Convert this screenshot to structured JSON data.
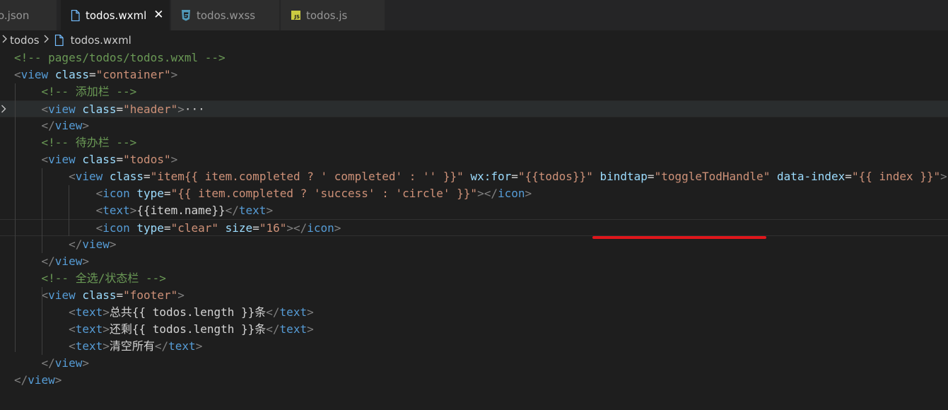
{
  "tabs": [
    {
      "label": "o.json",
      "icon": "json-file-icon",
      "active": false
    },
    {
      "label": "todos.wxml",
      "icon": "file-icon",
      "active": true
    },
    {
      "label": "todos.wxss",
      "icon": "css-file-icon",
      "active": false
    },
    {
      "label": "todos.js",
      "icon": "js-file-icon",
      "active": false
    }
  ],
  "tab_close_glyph": "✕",
  "js_badge_text": "JS",
  "breadcrumb": {
    "folder": "todos",
    "file": "todos.wxml"
  },
  "colors": {
    "tag": "#569cd6",
    "attribute": "#9cdcfe",
    "string": "#ce9178",
    "comment": "#6a9955",
    "bracket": "#808080",
    "annotation_underline": "#e0161b"
  },
  "code_lines": [
    [
      [
        "com",
        "<!-- pages/todos/todos.wxml -->"
      ]
    ],
    [
      [
        "b",
        "<"
      ],
      [
        "tag",
        "view"
      ],
      [
        "txt",
        " "
      ],
      [
        "attr",
        "class"
      ],
      [
        "txt",
        "="
      ],
      [
        "str",
        "\"container\""
      ],
      [
        "b",
        ">"
      ]
    ],
    [
      [
        "txt",
        "    "
      ],
      [
        "com",
        "<!-- 添加栏 -->"
      ]
    ],
    [
      [
        "txt",
        "    "
      ],
      [
        "b",
        "<"
      ],
      [
        "tag",
        "view"
      ],
      [
        "txt",
        " "
      ],
      [
        "attr",
        "class"
      ],
      [
        "txt",
        "="
      ],
      [
        "str",
        "\"header\""
      ],
      [
        "b",
        ">"
      ],
      [
        "ell",
        "···"
      ]
    ],
    [
      [
        "txt",
        "    "
      ],
      [
        "b",
        "</"
      ],
      [
        "tag",
        "view"
      ],
      [
        "b",
        ">"
      ]
    ],
    [
      [
        "txt",
        "    "
      ],
      [
        "com",
        "<!-- 待办栏 -->"
      ]
    ],
    [
      [
        "txt",
        "    "
      ],
      [
        "b",
        "<"
      ],
      [
        "tag",
        "view"
      ],
      [
        "txt",
        " "
      ],
      [
        "attr",
        "class"
      ],
      [
        "txt",
        "="
      ],
      [
        "str",
        "\"todos\""
      ],
      [
        "b",
        ">"
      ]
    ],
    [
      [
        "txt",
        "        "
      ],
      [
        "b",
        "<"
      ],
      [
        "tag",
        "view"
      ],
      [
        "txt",
        " "
      ],
      [
        "attr",
        "class"
      ],
      [
        "txt",
        "="
      ],
      [
        "str",
        "\"item{{ item.completed ? ' completed' : '' }}\""
      ],
      [
        "txt",
        " "
      ],
      [
        "attr",
        "wx:for"
      ],
      [
        "txt",
        "="
      ],
      [
        "str",
        "\"{{todos}}\""
      ],
      [
        "txt",
        " "
      ],
      [
        "attr",
        "bindtap"
      ],
      [
        "txt",
        "="
      ],
      [
        "str",
        "\"toggleTodHandle\""
      ],
      [
        "txt",
        " "
      ],
      [
        "attr",
        "data-index"
      ],
      [
        "txt",
        "="
      ],
      [
        "str",
        "\"{{ index }}\""
      ],
      [
        "b",
        ">"
      ]
    ],
    [
      [
        "txt",
        "            "
      ],
      [
        "b",
        "<"
      ],
      [
        "tag",
        "icon"
      ],
      [
        "txt",
        " "
      ],
      [
        "attr",
        "type"
      ],
      [
        "txt",
        "="
      ],
      [
        "str",
        "\"{{ item.completed ? 'success' : 'circle' }}\""
      ],
      [
        "b",
        "></"
      ],
      [
        "tag",
        "icon"
      ],
      [
        "b",
        ">"
      ]
    ],
    [
      [
        "txt",
        "            "
      ],
      [
        "b",
        "<"
      ],
      [
        "tag",
        "text"
      ],
      [
        "b",
        ">"
      ],
      [
        "txt",
        "{{item.name}}"
      ],
      [
        "b",
        "</"
      ],
      [
        "tag",
        "text"
      ],
      [
        "b",
        ">"
      ]
    ],
    [
      [
        "txt",
        "            "
      ],
      [
        "b",
        "<"
      ],
      [
        "tag",
        "icon"
      ],
      [
        "txt",
        " "
      ],
      [
        "attr",
        "type"
      ],
      [
        "txt",
        "="
      ],
      [
        "str",
        "\"clear\""
      ],
      [
        "txt",
        " "
      ],
      [
        "attr",
        "size"
      ],
      [
        "txt",
        "="
      ],
      [
        "str",
        "\"16\""
      ],
      [
        "b",
        "></"
      ],
      [
        "tag",
        "icon"
      ],
      [
        "b",
        ">"
      ]
    ],
    [
      [
        "txt",
        "        "
      ],
      [
        "b",
        "</"
      ],
      [
        "tag",
        "view"
      ],
      [
        "b",
        ">"
      ]
    ],
    [
      [
        "txt",
        "    "
      ],
      [
        "b",
        "</"
      ],
      [
        "tag",
        "view"
      ],
      [
        "b",
        ">"
      ]
    ],
    [
      [
        "txt",
        "    "
      ],
      [
        "com",
        "<!-- 全选/状态栏 -->"
      ]
    ],
    [
      [
        "txt",
        "    "
      ],
      [
        "b",
        "<"
      ],
      [
        "tag",
        "view"
      ],
      [
        "txt",
        " "
      ],
      [
        "attr",
        "class"
      ],
      [
        "txt",
        "="
      ],
      [
        "str",
        "\"footer\""
      ],
      [
        "b",
        ">"
      ]
    ],
    [
      [
        "txt",
        "        "
      ],
      [
        "b",
        "<"
      ],
      [
        "tag",
        "text"
      ],
      [
        "b",
        ">"
      ],
      [
        "txt",
        "总共{{ todos.length }}条"
      ],
      [
        "b",
        "</"
      ],
      [
        "tag",
        "text"
      ],
      [
        "b",
        ">"
      ]
    ],
    [
      [
        "txt",
        "        "
      ],
      [
        "b",
        "<"
      ],
      [
        "tag",
        "text"
      ],
      [
        "b",
        ">"
      ],
      [
        "txt",
        "还剩{{ todos.length }}条"
      ],
      [
        "b",
        "</"
      ],
      [
        "tag",
        "text"
      ],
      [
        "b",
        ">"
      ]
    ],
    [
      [
        "txt",
        "        "
      ],
      [
        "b",
        "<"
      ],
      [
        "tag",
        "text"
      ],
      [
        "b",
        ">"
      ],
      [
        "txt",
        "清空所有"
      ],
      [
        "b",
        "</"
      ],
      [
        "tag",
        "text"
      ],
      [
        "b",
        ">"
      ]
    ],
    [
      [
        "txt",
        "    "
      ],
      [
        "b",
        "</"
      ],
      [
        "tag",
        "view"
      ],
      [
        "b",
        ">"
      ]
    ],
    [
      [
        "b",
        "</"
      ],
      [
        "tag",
        "view"
      ],
      [
        "b",
        ">"
      ]
    ]
  ]
}
